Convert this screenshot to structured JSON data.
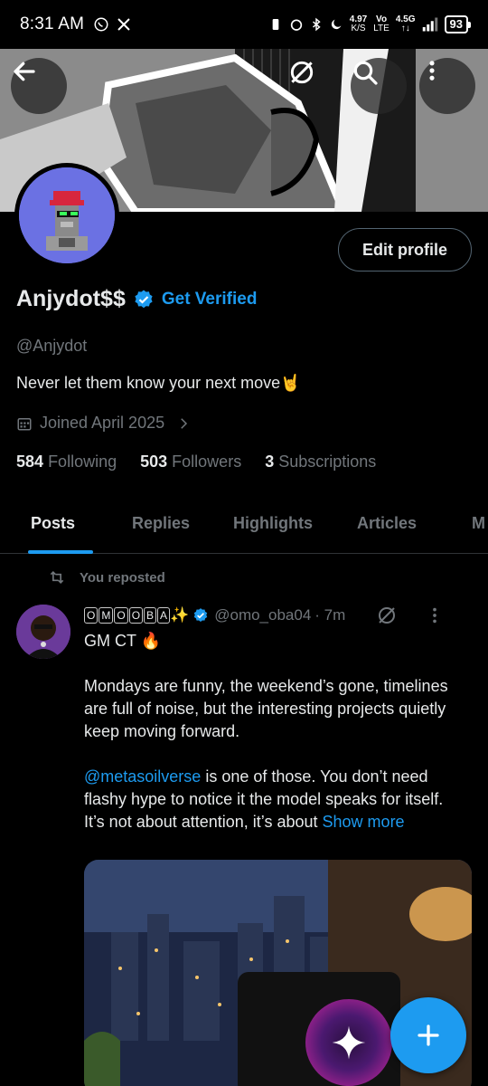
{
  "status_bar": {
    "time": "8:31 AM",
    "net_speed": "4.97",
    "net_unit": "K/S",
    "vo": "Vo",
    "lte": "LTE",
    "net_gen": "4.5G",
    "battery": "93"
  },
  "profile": {
    "display_name": "Anjydot$$",
    "get_verified_label": "Get Verified",
    "handle": "@Anjydot",
    "bio": "Never let them know your next move🤘",
    "joined": "Joined April 2025",
    "edit_profile_label": "Edit profile",
    "stats": [
      {
        "count": "584",
        "label": "Following"
      },
      {
        "count": "503",
        "label": "Followers"
      },
      {
        "count": "3",
        "label": "Subscriptions"
      }
    ]
  },
  "tabs": [
    {
      "label": "Posts",
      "active": true
    },
    {
      "label": "Replies",
      "active": false
    },
    {
      "label": "Highlights",
      "active": false
    },
    {
      "label": "Articles",
      "active": false
    },
    {
      "label": "M",
      "active": false
    }
  ],
  "post": {
    "repost_label": "You reposted",
    "author_letters": [
      "O",
      "M",
      "O",
      "O",
      "B",
      "A"
    ],
    "author_suffix": "✨",
    "author_handle": "@omo_oba04",
    "time": "· 7m",
    "line1": "GM CT 🔥",
    "para1": "Mondays are funny, the weekend’s gone, timelines are full of noise, but the interesting projects quietly keep moving forward.",
    "mention": "@metasoilverse",
    "para2_rest": " is one of those. You don’t need flashy hype to notice it the model speaks for itself. It’s not about attention, it’s about ",
    "show_more": "Show more"
  },
  "colors": {
    "accent": "#1d9bf0",
    "muted": "#71767b",
    "text": "#e7e9ea",
    "background": "#000000"
  },
  "icons": [
    "back-arrow-icon",
    "grok-slash-icon",
    "search-icon",
    "more-vertical-icon",
    "verified-badge-icon",
    "calendar-icon",
    "chevron-right-icon",
    "repost-icon",
    "plus-icon",
    "grok-sparkle-icon"
  ]
}
